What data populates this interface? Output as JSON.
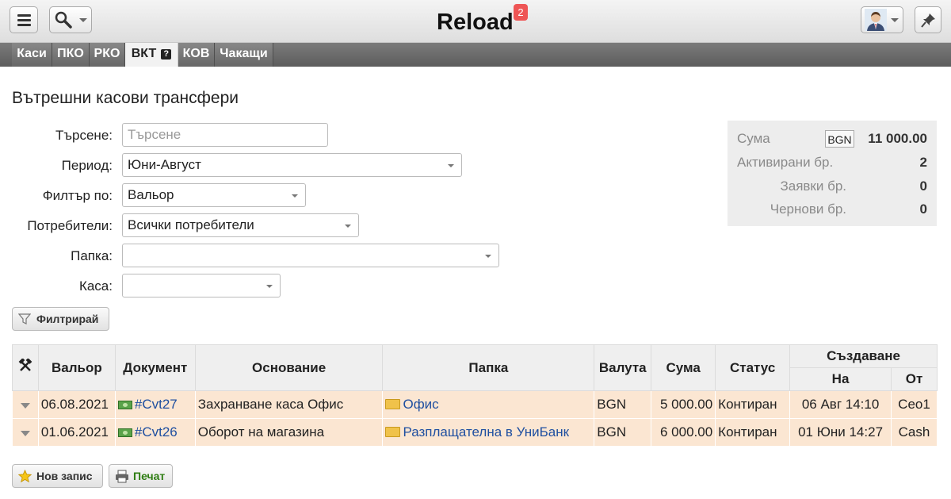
{
  "header": {
    "app_title": "Reload",
    "notifications_count": "2",
    "icons": [
      "menu-icon",
      "search-icon",
      "avatar",
      "pin-icon"
    ]
  },
  "tabs": [
    {
      "label": "Каси",
      "active": false
    },
    {
      "label": "ПКО",
      "active": false
    },
    {
      "label": "РКО",
      "active": false
    },
    {
      "label": "ВКТ",
      "active": true
    },
    {
      "label": "КОВ",
      "active": false
    },
    {
      "label": "Чакащи",
      "active": false
    }
  ],
  "page": {
    "title": "Вътрешни касови трансфери"
  },
  "filters": {
    "search_label": "Търсене:",
    "search_placeholder": "Търсене",
    "search_value": "",
    "period_label": "Период:",
    "period_value": "Юни-Август",
    "filter_by_label": "Филтър по:",
    "filter_by_value": "Вальор",
    "users_label": "Потребители:",
    "users_value": "Всички потребители",
    "folder_label": "Папка:",
    "folder_value": "",
    "cashbox_label": "Каса:",
    "cashbox_value": "",
    "filter_button": "Филтрирай"
  },
  "summary": {
    "amount_label": "Сума",
    "currency": "BGN",
    "amount_value": "11 000.00",
    "active_label": "Активирани бр.",
    "active_value": "2",
    "requests_label": "Заявки бр.",
    "requests_value": "0",
    "drafts_label": "Чернови бр.",
    "drafts_value": "0"
  },
  "table": {
    "headers": {
      "valor": "Вальор",
      "document": "Документ",
      "basis": "Основание",
      "folder": "Папка",
      "currency": "Валута",
      "amount": "Сума",
      "status": "Статус",
      "created": "Създаване",
      "created_on": "На",
      "created_by": "От"
    },
    "rows": [
      {
        "valor": "06.08.2021",
        "document": "#Cvt27",
        "basis": "Захранване каса Офис",
        "folder": "Офис",
        "currency": "BGN",
        "amount": "5 000.00",
        "status": "Контиран",
        "created_on": "06 Авг 14:10",
        "created_by": "Ceo1"
      },
      {
        "valor": "01.06.2021",
        "document": "#Cvt26",
        "basis": "Оборот на магазина",
        "folder": "Разплащателна в УниБанк",
        "currency": "BGN",
        "amount": "6 000.00",
        "status": "Контиран",
        "created_on": "01 Юни 14:27",
        "created_by": "Cash"
      }
    ]
  },
  "actions": {
    "new_record": "Нов запис",
    "print": "Печат"
  },
  "colors": {
    "row_bg": "#fbe6d2",
    "link": "#1f4fa0",
    "creator_cash": "#3a7a1c",
    "badge": "#e55555"
  }
}
